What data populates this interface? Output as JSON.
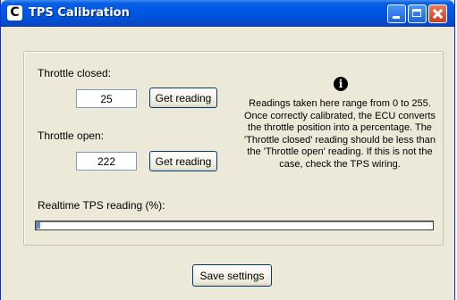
{
  "window": {
    "title": "TPS Calibration"
  },
  "titlebar_buttons": {
    "minimize": "minimize-icon",
    "maximize": "maximize-icon",
    "close": "close-icon"
  },
  "calibration": {
    "closed_label": "Throttle closed:",
    "closed_value": "25",
    "open_label": "Throttle open:",
    "open_value": "222",
    "get_reading_label": "Get reading"
  },
  "info": {
    "icon": "info-icon",
    "text": "Readings taken here range from 0 to 255. Once correctly calibrated, the ECU converts the throttle position into a percentage. The 'Throttle closed' reading should be less than the 'Throttle open' reading. If this is not the case, check the TPS wiring."
  },
  "realtime": {
    "label": "Realtime TPS reading (%):",
    "progress_percent": 1
  },
  "footer": {
    "save_label": "Save settings"
  }
}
